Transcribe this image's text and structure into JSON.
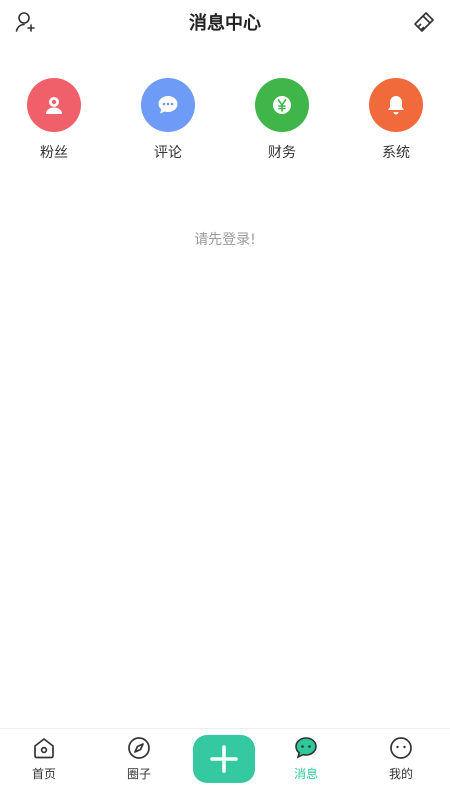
{
  "header": {
    "title": "消息中心"
  },
  "quick_items": [
    {
      "label": "粉丝",
      "color": "#f0606a",
      "icon": "user-badge-icon"
    },
    {
      "label": "评论",
      "color": "#6d9bf5",
      "icon": "comment-icon"
    },
    {
      "label": "财务",
      "color": "#3fb54a",
      "icon": "yen-icon"
    },
    {
      "label": "系统",
      "color": "#f06a3c",
      "icon": "bell-icon"
    }
  ],
  "empty_text": "请先登录!",
  "tabs": [
    {
      "label": "首页",
      "icon": "home-icon",
      "active": false
    },
    {
      "label": "圈子",
      "icon": "compass-icon",
      "active": false
    },
    {
      "label": "消息",
      "icon": "chat-icon",
      "active": true
    },
    {
      "label": "我的",
      "icon": "smile-icon",
      "active": false
    }
  ],
  "colors": {
    "accent": "#2ec99a",
    "plus_button": "#34c9a0"
  }
}
